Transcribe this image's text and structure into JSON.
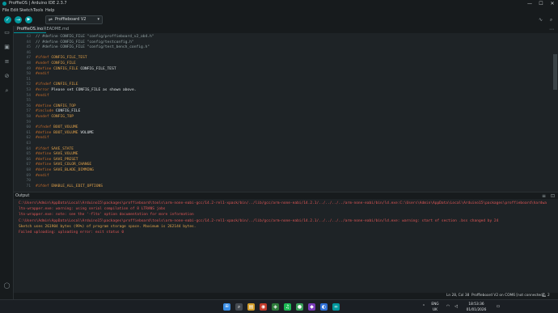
{
  "window": {
    "title": "ProffieOS | Arduino IDE 2.3.7",
    "controls": {
      "minimize": "—",
      "maximize": "☐",
      "close": "✕"
    }
  },
  "menu": [
    "File",
    "Edit",
    "Sketch",
    "Tools",
    "Help"
  ],
  "toolbar": {
    "verify": "✓",
    "upload": "→",
    "debug": "▶",
    "board": "Proffieboard V2",
    "board_icon": "usb-icon"
  },
  "tabs": [
    "ProffieOS.ino",
    "README.md"
  ],
  "editor": {
    "lines": [
      {
        "n": "43",
        "segs": [
          {
            "t": "// #define CONFIG_FILE \"config/proffieboard_v2_ob4.h\"",
            "c": "cm"
          }
        ]
      },
      {
        "n": "44",
        "segs": [
          {
            "t": "// #define CONFIG_FILE \"config/testconfig.h\"",
            "c": "cm"
          }
        ]
      },
      {
        "n": "45",
        "segs": [
          {
            "t": "// #define CONFIG_FILE \"config/test_bench_config.h\"",
            "c": "cm"
          }
        ]
      },
      {
        "n": "46",
        "segs": []
      },
      {
        "n": "47",
        "segs": [
          {
            "t": "#ifdef ",
            "c": "pp"
          },
          {
            "t": "CONFIG_FILE_TEST",
            "c": "mac"
          }
        ]
      },
      {
        "n": "48",
        "segs": [
          {
            "t": "#undef ",
            "c": "pp"
          },
          {
            "t": "CONFIG_FILE",
            "c": "mac"
          }
        ]
      },
      {
        "n": "49",
        "segs": [
          {
            "t": "#define ",
            "c": "pp"
          },
          {
            "t": "CONFIG_FILE",
            "c": "mac"
          },
          {
            "t": " CONFIG_FILE_TEST",
            "c": "txt"
          }
        ]
      },
      {
        "n": "50",
        "segs": [
          {
            "t": "#endif",
            "c": "pp"
          }
        ]
      },
      {
        "n": "51",
        "segs": []
      },
      {
        "n": "52",
        "segs": [
          {
            "t": "#ifndef ",
            "c": "pp"
          },
          {
            "t": "CONFIG_FILE",
            "c": "mac"
          }
        ]
      },
      {
        "n": "53",
        "segs": [
          {
            "t": "#error ",
            "c": "pp"
          },
          {
            "t": "Please set CONFIG_FILE as shown above.",
            "c": "txt"
          }
        ]
      },
      {
        "n": "54",
        "segs": [
          {
            "t": "#endif",
            "c": "pp"
          }
        ]
      },
      {
        "n": "55",
        "segs": []
      },
      {
        "n": "56",
        "segs": [
          {
            "t": "#define ",
            "c": "pp"
          },
          {
            "t": "CONFIG_TOP",
            "c": "mac"
          }
        ]
      },
      {
        "n": "57",
        "segs": [
          {
            "t": "#include ",
            "c": "pp"
          },
          {
            "t": "CONFIG_FILE",
            "c": "txt"
          }
        ]
      },
      {
        "n": "58",
        "segs": [
          {
            "t": "#undef ",
            "c": "pp"
          },
          {
            "t": "CONFIG_TOP",
            "c": "mac"
          }
        ]
      },
      {
        "n": "59",
        "segs": []
      },
      {
        "n": "60",
        "segs": [
          {
            "t": "#ifndef ",
            "c": "pp"
          },
          {
            "t": "BOOT_VOLUME",
            "c": "mac"
          }
        ]
      },
      {
        "n": "61",
        "segs": [
          {
            "t": "#define ",
            "c": "pp"
          },
          {
            "t": "BOOT_VOLUME",
            "c": "mac"
          },
          {
            "t": " VOLUME",
            "c": "txt"
          }
        ]
      },
      {
        "n": "62",
        "segs": [
          {
            "t": "#endif",
            "c": "pp"
          }
        ]
      },
      {
        "n": "63",
        "segs": []
      },
      {
        "n": "64",
        "segs": [
          {
            "t": "#ifdef ",
            "c": "pp"
          },
          {
            "t": "SAVE_STATE",
            "c": "mac"
          }
        ]
      },
      {
        "n": "65",
        "segs": [
          {
            "t": "#define ",
            "c": "pp"
          },
          {
            "t": "SAVE_VOLUME",
            "c": "mac"
          }
        ]
      },
      {
        "n": "66",
        "segs": [
          {
            "t": "#define ",
            "c": "pp"
          },
          {
            "t": "SAVE_PRESET",
            "c": "mac"
          }
        ]
      },
      {
        "n": "67",
        "segs": [
          {
            "t": "#define ",
            "c": "pp"
          },
          {
            "t": "SAVE_COLOR_CHANGE",
            "c": "mac"
          }
        ]
      },
      {
        "n": "68",
        "segs": [
          {
            "t": "#define ",
            "c": "pp"
          },
          {
            "t": "SAVE_BLADE_DIMMING",
            "c": "mac"
          }
        ]
      },
      {
        "n": "69",
        "segs": [
          {
            "t": "#endif",
            "c": "pp"
          }
        ]
      },
      {
        "n": "70",
        "segs": []
      },
      {
        "n": "71",
        "segs": [
          {
            "t": "#ifdef ",
            "c": "pp"
          },
          {
            "t": "ENABLE_ALL_EDIT_OPTIONS",
            "c": "mac"
          }
        ]
      }
    ]
  },
  "output": {
    "title": "Output",
    "lines": [
      {
        "t": "C:\\Users\\Admin\\AppData\\Local\\Arduino15\\packages\\proffieboard\\tools\\arm-none-eabi-gcc/14.2-rel1-xpack/bin/../lib/gcc/arm-none-eabi/14.2.1/../../../../arm-none-eabi/bin/ld.exe:C:\\Users\\Admin\\AppData\\Local\\Arduino15\\packages\\proffieboard\\hardwa",
        "c": "err"
      },
      {
        "t": "lto-wrapper.exe: warning: using serial compilation of 8 LTRANS jobs",
        "c": "err"
      },
      {
        "t": "lto-wrapper.exe: note: see the '-flto' option documentation for more information",
        "c": "err"
      },
      {
        "t": "C:\\Users\\Admin\\AppData\\Local\\Arduino15\\packages\\proffieboard\\tools\\arm-none-eabi-gcc/14.2-rel1-xpack/bin/../lib/gcc/arm-none-eabi/14.2.1/../../../../arm-none-eabi/bin/ld.exe: warning: start of section .bss changed by 24",
        "c": "err"
      },
      {
        "t": "Sketch uses 261904 bytes (99%) of program storage space. Maximum is 262144 bytes.",
        "c": "warn"
      },
      {
        "t": "Failed uploading: uploading error: exit status 0",
        "c": "err"
      }
    ]
  },
  "status": {
    "position": "Ln 28, Col 38",
    "board_port": "Proffieboard V2 on COM6 [not connected]",
    "notifications": "2"
  },
  "taskbar": {
    "lang_top": "ENG",
    "lang_bottom": "UK",
    "time": "18:53:36",
    "date": "01/01/2026"
  },
  "colors": {
    "accent": "#00979d",
    "error": "#e05656",
    "preprocessor": "#c46b2a",
    "macro": "#e2a24a"
  }
}
